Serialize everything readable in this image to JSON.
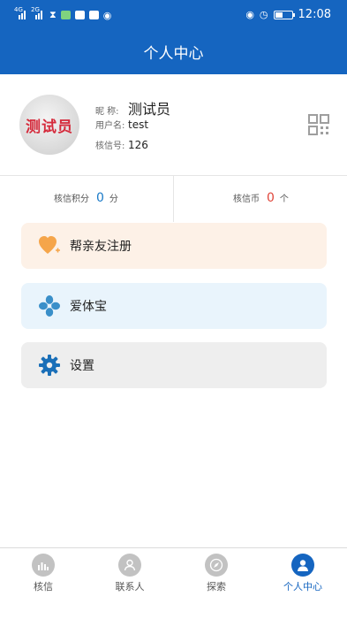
{
  "status_bar": {
    "signal1": "4G",
    "signal2": "2G",
    "time": "12:08"
  },
  "header": {
    "title": "个人中心"
  },
  "profile": {
    "avatar_text": "测试员",
    "nickname_label": "昵  称:",
    "nickname": "测试员",
    "username_label": "用户名:",
    "username": "test",
    "account_label": "核信号:",
    "account_no": "126",
    "qr_icon": "qr-code-icon"
  },
  "stats": {
    "points_label": "核信积分",
    "points_value": "0",
    "points_unit": "分",
    "coins_label": "核信币",
    "coins_value": "0",
    "coins_unit": "个"
  },
  "menu": [
    {
      "label": "帮亲友注册",
      "icon": "heart-plus-icon",
      "color": "#f5a54a"
    },
    {
      "label": "爱体宝",
      "icon": "clover-icon",
      "color": "#3a8fc9"
    },
    {
      "label": "设置",
      "icon": "gear-icon",
      "color": "#1a6fb8"
    }
  ],
  "tabs": [
    {
      "label": "核信",
      "icon": "chart-icon",
      "active": false
    },
    {
      "label": "联系人",
      "icon": "contacts-icon",
      "active": false
    },
    {
      "label": "探索",
      "icon": "compass-icon",
      "active": false
    },
    {
      "label": "个人中心",
      "icon": "person-icon",
      "active": true
    }
  ],
  "colors": {
    "primary": "#1565c0",
    "points_value": "#1a7ac8",
    "coins_value": "#e0453a"
  }
}
